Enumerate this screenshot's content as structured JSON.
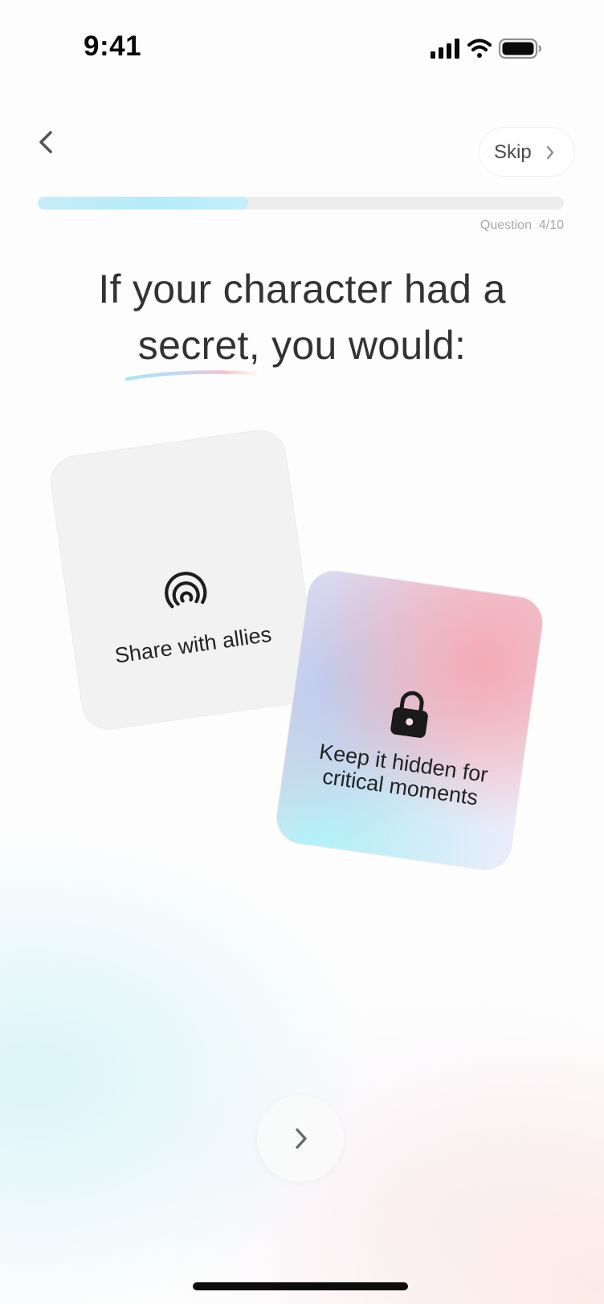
{
  "status_bar": {
    "time": "9:41"
  },
  "header": {
    "back_icon": "chevron-left-icon",
    "skip_label": "Skip",
    "skip_icon": "chevron-right-icon"
  },
  "progress": {
    "current": 4,
    "total": 10,
    "fraction": 0.4,
    "label": "Question  4/10"
  },
  "question": {
    "line1": "If your character had a",
    "line2": "secret, you would:",
    "highlight_word": "secret"
  },
  "options": [
    {
      "label": "Share with allies",
      "icon": "broadcast-signal-icon",
      "selected": false
    },
    {
      "label": "Keep it hidden for critical moments",
      "icon": "lock-icon",
      "selected": true
    }
  ],
  "footer": {
    "next_icon": "chevron-right-icon"
  },
  "colors": {
    "progress_fill": "#b4ecfa",
    "title_text": "#333333",
    "selected_card_pink": "#f4aab4",
    "selected_card_cyan": "#b2f3fa"
  }
}
